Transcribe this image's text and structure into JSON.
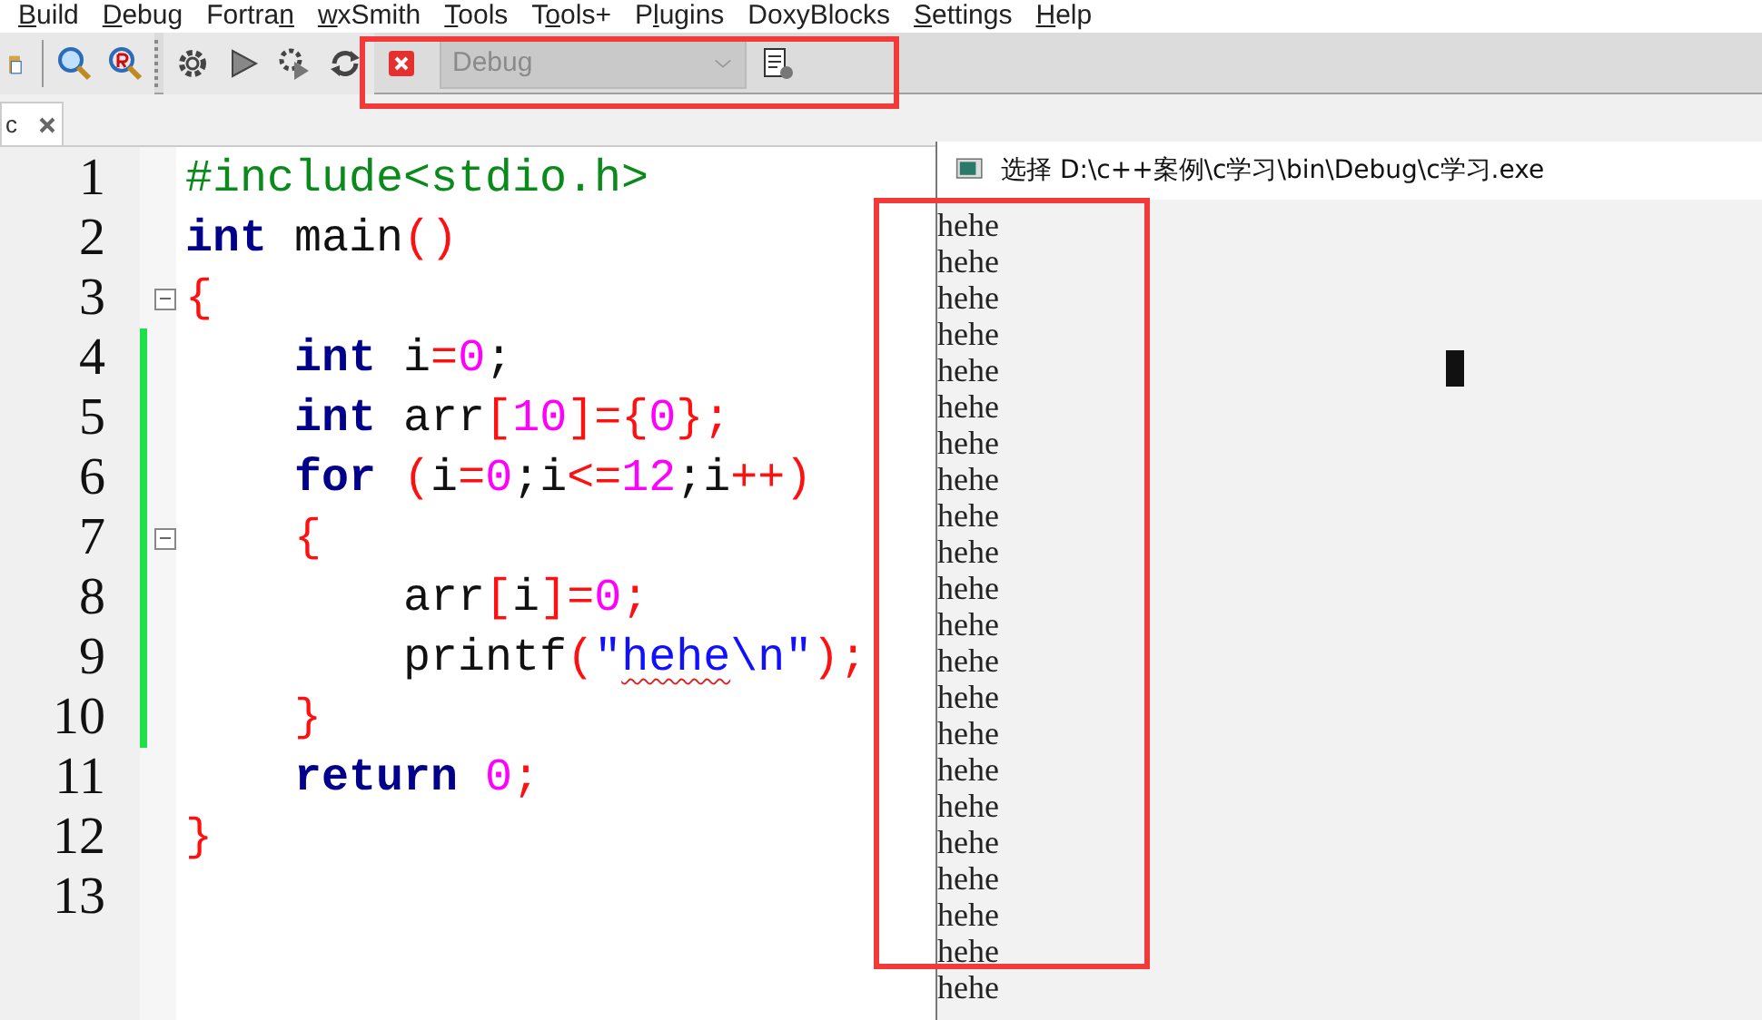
{
  "menu": [
    {
      "key": "B",
      "post": "uild"
    },
    {
      "key": "D",
      "post": "ebug"
    },
    {
      "pre": "Fortra",
      "key": "n"
    },
    {
      "key": "w",
      "post": "xSmith"
    },
    {
      "key": "T",
      "post": "ools"
    },
    {
      "pre": "T",
      "key": "o",
      "post": "ols+"
    },
    {
      "pre": "P",
      "key": "l",
      "post": "ugins"
    },
    {
      "pre": "DoxyBlocks"
    },
    {
      "key": "S",
      "post": "ettings"
    },
    {
      "key": "H",
      "post": "elp"
    }
  ],
  "toolbar": {
    "build_target": {
      "value": "Debug",
      "disabled": true
    }
  },
  "editor": {
    "tab": {
      "label": "c"
    },
    "lines": [
      {
        "number": "1",
        "fold": false,
        "changed": false,
        "tokens": [
          {
            "text": "#include<stdio.h>",
            "kind": "preprocessor"
          }
        ]
      },
      {
        "number": "2",
        "fold": false,
        "changed": false,
        "tokens": [
          {
            "text": "int",
            "kind": "keyword"
          },
          {
            "text": " main",
            "kind": "plain"
          },
          {
            "text": "()",
            "kind": "operator"
          }
        ]
      },
      {
        "number": "3",
        "fold": true,
        "changed": false,
        "tokens": [
          {
            "text": "{",
            "kind": "operator"
          }
        ]
      },
      {
        "number": "4",
        "fold": false,
        "changed": true,
        "tokens": [
          {
            "text": "    int",
            "kind": "keyword"
          },
          {
            "text": " i",
            "kind": "plain"
          },
          {
            "text": "=",
            "kind": "operator"
          },
          {
            "text": "0",
            "kind": "number"
          },
          {
            "text": ";",
            "kind": "plain"
          }
        ]
      },
      {
        "number": "5",
        "fold": false,
        "changed": true,
        "tokens": [
          {
            "text": "    int",
            "kind": "keyword"
          },
          {
            "text": " arr",
            "kind": "plain"
          },
          {
            "text": "[",
            "kind": "operator"
          },
          {
            "text": "10",
            "kind": "number"
          },
          {
            "text": "]={",
            "kind": "operator"
          },
          {
            "text": "0",
            "kind": "number"
          },
          {
            "text": "};",
            "kind": "operator"
          }
        ]
      },
      {
        "number": "6",
        "fold": false,
        "changed": true,
        "tokens": [
          {
            "text": "    for",
            "kind": "keyword"
          },
          {
            "text": " (",
            "kind": "operator"
          },
          {
            "text": "i",
            "kind": "plain"
          },
          {
            "text": "=",
            "kind": "operator"
          },
          {
            "text": "0",
            "kind": "number"
          },
          {
            "text": ";i",
            "kind": "plain"
          },
          {
            "text": "<=",
            "kind": "operator"
          },
          {
            "text": "12",
            "kind": "number"
          },
          {
            "text": ";i",
            "kind": "plain"
          },
          {
            "text": "++)",
            "kind": "operator"
          }
        ]
      },
      {
        "number": "7",
        "fold": true,
        "changed": true,
        "tokens": [
          {
            "text": "    {",
            "kind": "operator"
          }
        ]
      },
      {
        "number": "8",
        "fold": false,
        "changed": true,
        "tokens": [
          {
            "text": "        arr",
            "kind": "plain"
          },
          {
            "text": "[",
            "kind": "operator"
          },
          {
            "text": "i",
            "kind": "plain"
          },
          {
            "text": "]=",
            "kind": "operator"
          },
          {
            "text": "0",
            "kind": "number"
          },
          {
            "text": ";",
            "kind": "operator"
          }
        ]
      },
      {
        "number": "9",
        "fold": false,
        "changed": true,
        "tokens": [
          {
            "text": "        printf",
            "kind": "plain"
          },
          {
            "text": "(",
            "kind": "operator"
          },
          {
            "text": "\"",
            "kind": "string"
          },
          {
            "text": "hehe",
            "kind": "misspelled"
          },
          {
            "text": "\\n\"",
            "kind": "string"
          },
          {
            "text": ");",
            "kind": "operator"
          }
        ]
      },
      {
        "number": "10",
        "fold": false,
        "changed": true,
        "tokens": [
          {
            "text": "    }",
            "kind": "operator"
          }
        ]
      },
      {
        "number": "11",
        "fold": false,
        "changed": false,
        "tokens": [
          {
            "text": "    return ",
            "kind": "keyword"
          },
          {
            "text": "0",
            "kind": "number"
          },
          {
            "text": ";",
            "kind": "operator"
          }
        ]
      },
      {
        "number": "12",
        "fold": false,
        "changed": false,
        "tokens": [
          {
            "text": "}",
            "kind": "operator"
          }
        ]
      },
      {
        "number": "13",
        "fold": false,
        "changed": false
      }
    ]
  },
  "console": {
    "title": "选择 D:\\c++案例\\c学习\\bin\\Debug\\c学习.exe",
    "output": [
      "hehe",
      "hehe",
      "hehe",
      "hehe",
      "hehe",
      "hehe",
      "hehe",
      "hehe",
      "hehe",
      "hehe",
      "hehe",
      "hehe",
      "hehe",
      "hehe",
      "hehe",
      "hehe",
      "hehe",
      "hehe",
      "hehe",
      "hehe",
      "hehe",
      "hehe"
    ]
  }
}
